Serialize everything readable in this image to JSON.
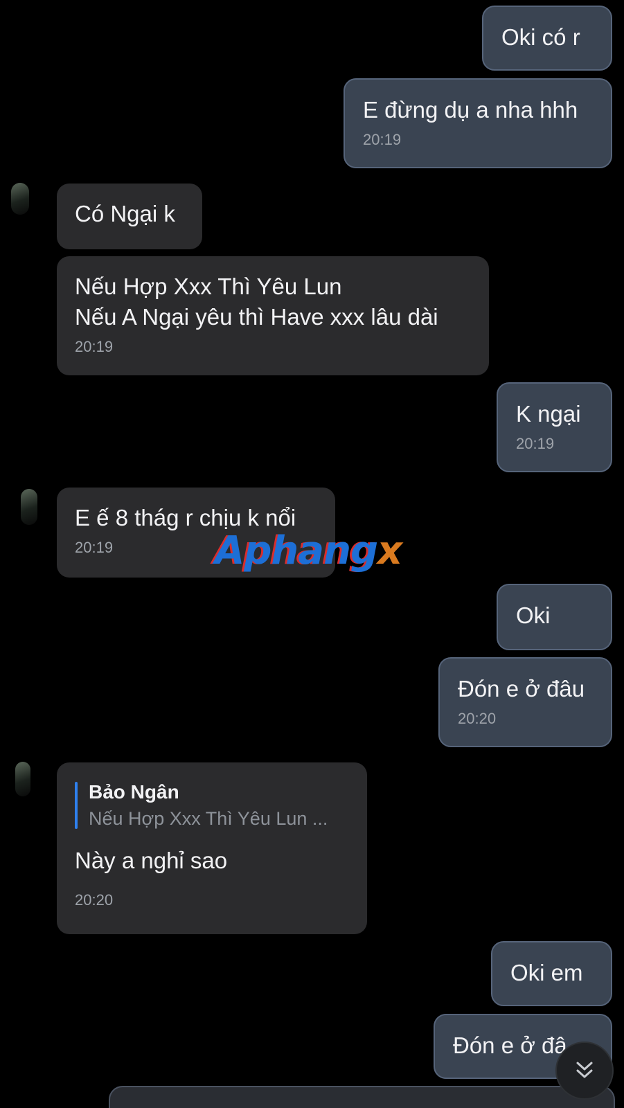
{
  "colors": {
    "background": "#000000",
    "outgoing_bubble": "#3a4452",
    "incoming_bubble": "#2b2b2d",
    "reply_accent": "#2f80ed",
    "timestamp": "#9ea3aa"
  },
  "messages": [
    {
      "direction": "outgoing",
      "text": "Oki có r",
      "time": ""
    },
    {
      "direction": "outgoing",
      "text": "E đừng dụ a nha hhh",
      "time": "20:19"
    },
    {
      "direction": "incoming",
      "text": "Có Ngại k",
      "time": ""
    },
    {
      "direction": "incoming",
      "text": "Nếu Hợp Xxx Thì Yêu Lun\nNếu A Ngại yêu thì Have xxx lâu dài",
      "time": "20:19"
    },
    {
      "direction": "outgoing",
      "text": "K ngại",
      "time": "20:19"
    },
    {
      "direction": "incoming",
      "text": "E ế 8 thág r chịu k nổi",
      "time": "20:19"
    },
    {
      "direction": "outgoing",
      "text": "Oki",
      "time": ""
    },
    {
      "direction": "outgoing",
      "text": "Đón e ở đâu",
      "time": "20:20"
    },
    {
      "direction": "incoming",
      "reply_to": {
        "sender": "Bảo Ngân",
        "snippet": "Nếu Hợp Xxx Thì Yêu Lun ..."
      },
      "text": "Này a nghỉ sao",
      "time": "20:20"
    },
    {
      "direction": "outgoing",
      "text": "Oki em",
      "time": ""
    },
    {
      "direction": "outgoing",
      "text": "Đón e ở đâ",
      "time": ""
    }
  ],
  "watermark": {
    "main": "Aphang",
    "suffix": "x"
  },
  "scroll_button": {
    "icon": "double-chevron-down-icon"
  }
}
